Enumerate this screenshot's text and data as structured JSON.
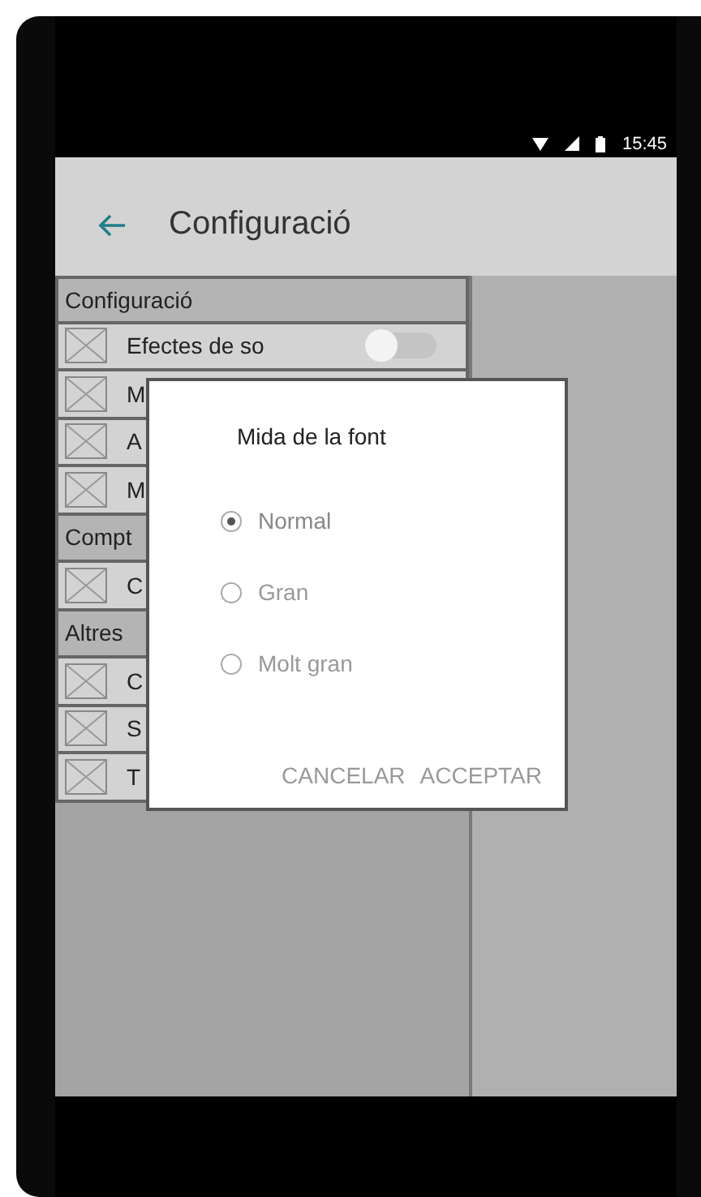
{
  "status_bar": {
    "time": "15:45"
  },
  "app_bar": {
    "title": "Configuració"
  },
  "list": [
    {
      "kind": "header",
      "label": "Configuració"
    },
    {
      "kind": "switch",
      "label": "Efectes de so",
      "on": false
    },
    {
      "kind": "item",
      "label": "M"
    },
    {
      "kind": "item",
      "label": "A"
    },
    {
      "kind": "item",
      "label": "M"
    },
    {
      "kind": "header",
      "label": "Compt"
    },
    {
      "kind": "item",
      "label": "C"
    },
    {
      "kind": "header",
      "label": "Altres"
    },
    {
      "kind": "item",
      "label": "C"
    },
    {
      "kind": "item",
      "label": "S"
    },
    {
      "kind": "item",
      "label": "T"
    }
  ],
  "dialog": {
    "title": "Mida de la font",
    "options": [
      {
        "label": "Normal",
        "selected": true
      },
      {
        "label": "Gran",
        "selected": false
      },
      {
        "label": "Molt gran",
        "selected": false
      }
    ],
    "buttons": [
      "CANCELAR",
      "ACCEPTAR"
    ]
  }
}
